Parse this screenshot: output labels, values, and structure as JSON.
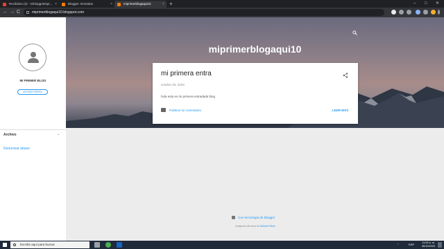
{
  "browser": {
    "tabs": [
      {
        "title": "Recibidos (2) - mibloggratispr...",
        "favicon_color": "#ea4335",
        "active": false
      },
      {
        "title": "Blogger: Entradas",
        "favicon_color": "#f57c00",
        "active": false
      },
      {
        "title": "miprimerblogaqui10",
        "favicon_color": "#f57c00",
        "active": true
      }
    ],
    "new_tab_label": "+",
    "url": "miprimerblogaqui10.blogspot.com",
    "back_label": "←",
    "forward_label": "→",
    "reload_label": "C",
    "minimize_label": "–",
    "maximize_label": "□",
    "close_label": "✕",
    "tab_close_label": "×"
  },
  "sidebar": {
    "blog_name": "MI PRIMER BLOG",
    "visit_profile_label": "VISITAR PERFIL",
    "archive_label": "Archivo",
    "archive_chevron": "⌄",
    "report_abuse_label": "Denunciar abuso"
  },
  "header": {
    "blog_title": "miprimerblogaqui10"
  },
  "post": {
    "title": "mi primera entra",
    "date": "octubre 30, 2023",
    "body": "hola esta es mi primera entradade blog",
    "comment_label": "Publicar un comentario",
    "read_more_label": "LEER MÁS"
  },
  "footer": {
    "powered_by": "Con tecnología de Blogger",
    "images_by_prefix": "Imágenes del tema de",
    "images_by_author": "Michael Elkan"
  },
  "taskbar": {
    "search_placeholder": "Escribe aquí para buscar",
    "language": "ESP",
    "time": "11:03 a. m.",
    "date": "30/10/2023"
  },
  "colors": {
    "accent": "#2196f3",
    "tabbar": "#202124",
    "toolbar": "#35363a",
    "taskbar": "#1f2a3a"
  }
}
